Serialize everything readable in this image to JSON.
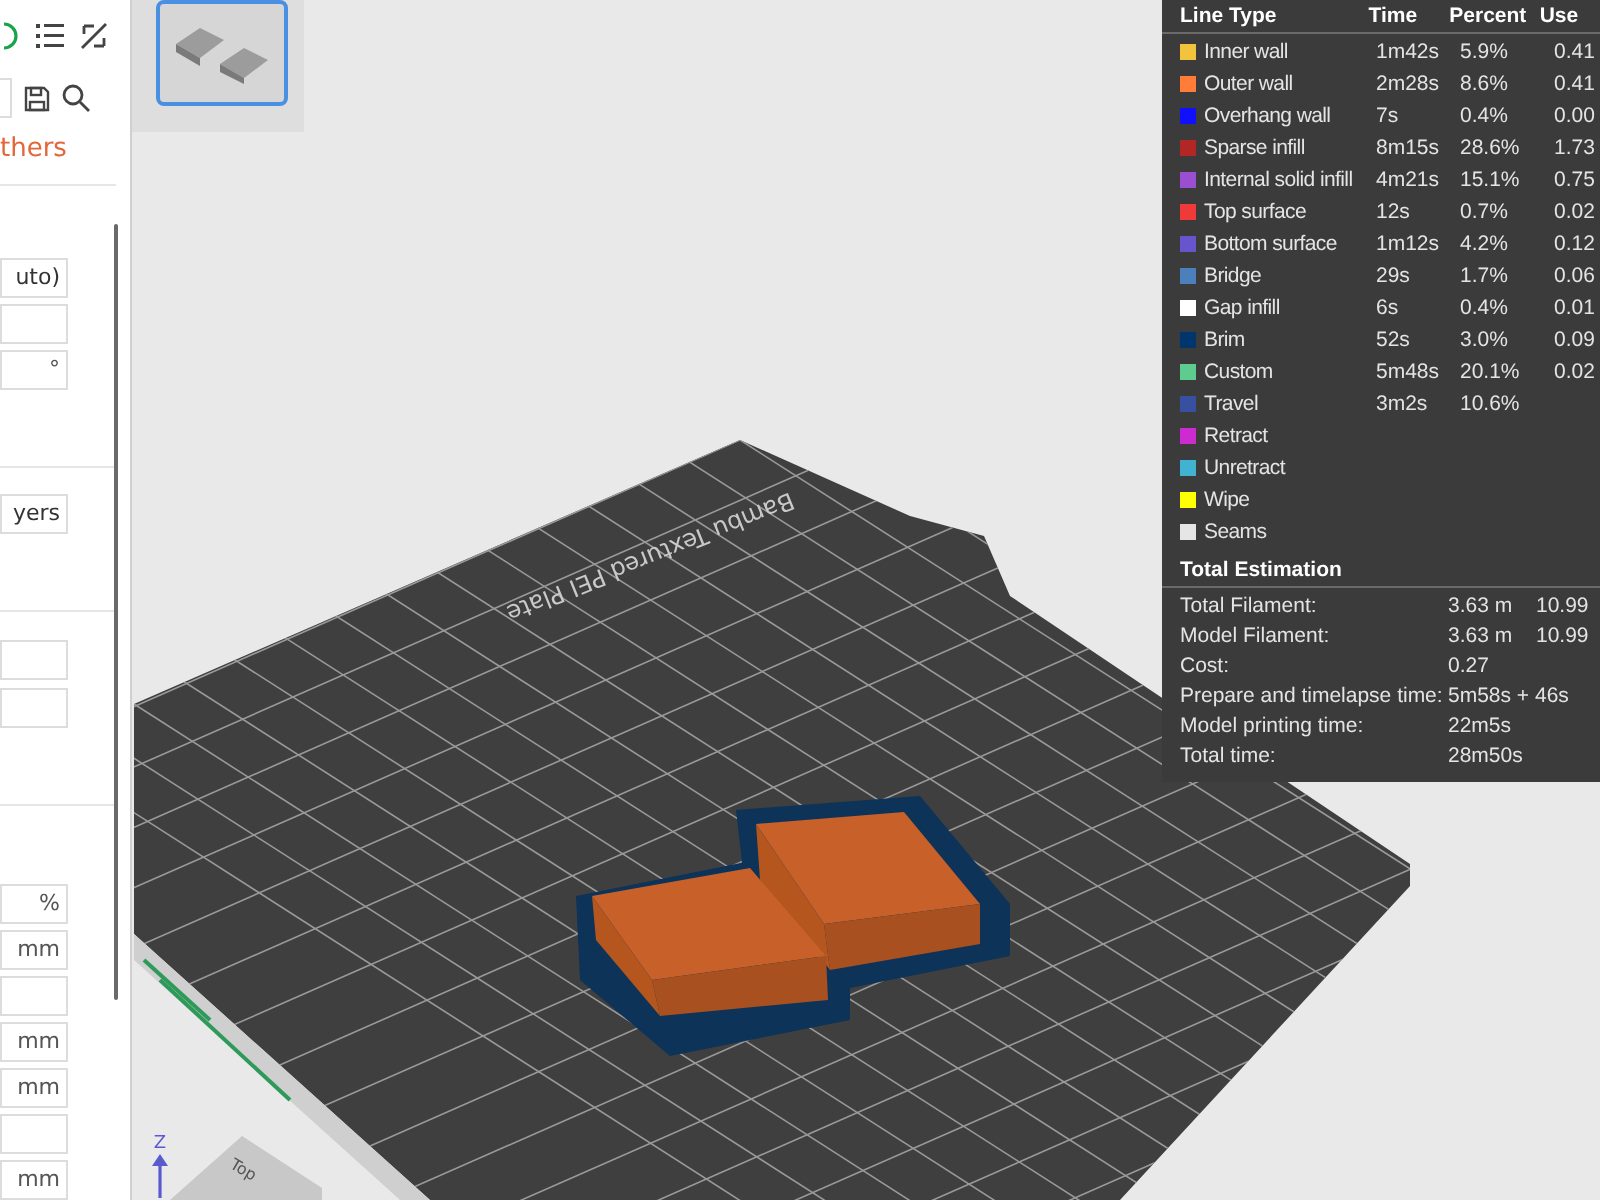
{
  "sidebar": {
    "tab_label": "thers",
    "sections": [
      {
        "fields": [
          {
            "kind": "text",
            "value": "uto)"
          },
          {
            "kind": "blank"
          },
          {
            "kind": "unit",
            "unit": "°"
          }
        ]
      },
      {
        "fields": [
          {
            "kind": "text",
            "value": "yers"
          }
        ]
      },
      {
        "fields": [
          {
            "kind": "blank"
          },
          {
            "kind": "blank"
          }
        ]
      },
      {
        "fields": [
          {
            "kind": "unit",
            "unit": "%"
          },
          {
            "kind": "unit",
            "unit": "mm"
          },
          {
            "kind": "blank"
          },
          {
            "kind": "unit",
            "unit": "mm"
          },
          {
            "kind": "unit",
            "unit": "mm"
          },
          {
            "kind": "blank"
          },
          {
            "kind": "unit",
            "unit": "mm"
          }
        ]
      }
    ]
  },
  "plate": {
    "label": "Bambu Textured PEI Plate",
    "view_cube": "Top",
    "axis": "Z"
  },
  "legend": {
    "columns": [
      "Line Type",
      "Time",
      "Percent",
      "Use"
    ],
    "rows": [
      {
        "name": "Inner wall",
        "color": "#f2c43d",
        "time": "1m42s",
        "percent": "5.9%",
        "used": "0.41"
      },
      {
        "name": "Outer wall",
        "color": "#ff7d38",
        "time": "2m28s",
        "percent": "8.6%",
        "used": "0.41"
      },
      {
        "name": "Overhang wall",
        "color": "#1010ff",
        "time": "7s",
        "percent": "0.4%",
        "used": "0.00"
      },
      {
        "name": "Sparse infill",
        "color": "#b22626",
        "time": "8m15s",
        "percent": "28.6%",
        "used": "1.73"
      },
      {
        "name": "Internal solid infill",
        "color": "#9a4fd0",
        "time": "4m21s",
        "percent": "15.1%",
        "used": "0.75"
      },
      {
        "name": "Top surface",
        "color": "#f03a3a",
        "time": "12s",
        "percent": "0.7%",
        "used": "0.02"
      },
      {
        "name": "Bottom surface",
        "color": "#6655cc",
        "time": "1m12s",
        "percent": "4.2%",
        "used": "0.12"
      },
      {
        "name": "Bridge",
        "color": "#4d80ba",
        "time": "29s",
        "percent": "1.7%",
        "used": "0.06"
      },
      {
        "name": "Gap infill",
        "color": "#ffffff",
        "time": "6s",
        "percent": "0.4%",
        "used": "0.01"
      },
      {
        "name": "Brim",
        "color": "#00366b",
        "time": "52s",
        "percent": "3.0%",
        "used": "0.09"
      },
      {
        "name": "Custom",
        "color": "#5ecc8e",
        "time": "5m48s",
        "percent": "20.1%",
        "used": "0.02"
      },
      {
        "name": "Travel",
        "color": "#3850a0",
        "time": "3m2s",
        "percent": "10.6%"
      },
      {
        "name": "Retract",
        "color": "#cd2ad0"
      },
      {
        "name": "Unretract",
        "color": "#40b3d0"
      },
      {
        "name": "Wipe",
        "color": "#ffff00"
      },
      {
        "name": "Seams",
        "color": "#e6e6e6"
      }
    ],
    "total_title": "Total Estimation",
    "totals": [
      {
        "label": "Total Filament:",
        "value": "3.63 m",
        "weight": "10.99"
      },
      {
        "label": "Model Filament:",
        "value": "3.63 m",
        "weight": "10.99"
      },
      {
        "label": "Cost:",
        "value": "0.27"
      },
      {
        "label": "Prepare and timelapse time:",
        "value": "5m58s + 46s"
      },
      {
        "label": "Model printing time:",
        "value": "22m5s"
      },
      {
        "label": "Total time:",
        "value": "28m50s"
      }
    ]
  }
}
